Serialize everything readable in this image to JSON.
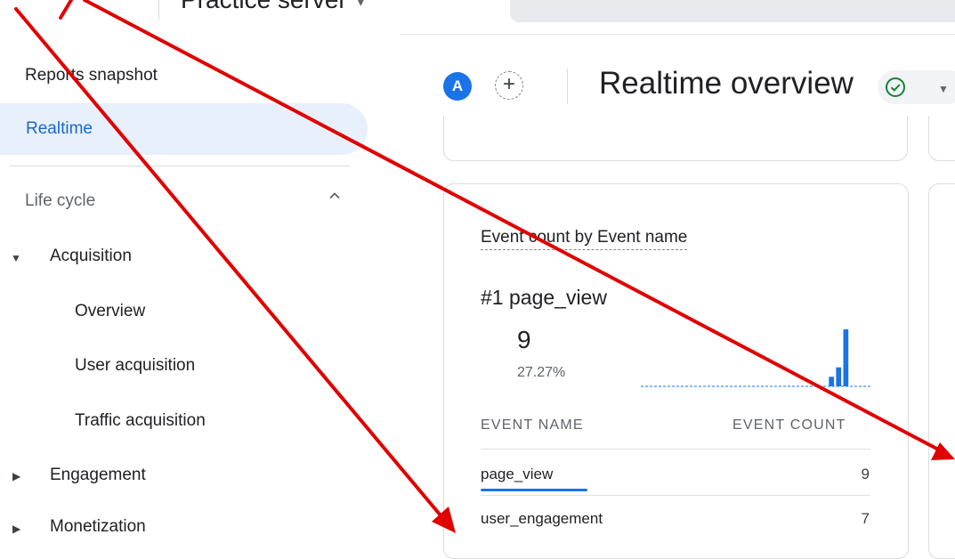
{
  "topbar": {
    "property_name": "Practice server",
    "property_caret": "▾"
  },
  "sidebar": {
    "items": [
      {
        "label": "Reports snapshot"
      },
      {
        "label": "Realtime",
        "active": true
      }
    ],
    "section": {
      "label": "Life cycle"
    },
    "groups": [
      {
        "label": "Acquisition",
        "expanded": true,
        "children": [
          "Overview",
          "User acquisition",
          "Traffic acquisition"
        ]
      },
      {
        "label": "Engagement",
        "expanded": false
      },
      {
        "label": "Monetization",
        "expanded": false
      }
    ]
  },
  "header": {
    "avatar_letter": "A",
    "add_label": "+",
    "title": "Realtime overview"
  },
  "card": {
    "title": "Event count by Event name",
    "rank": "#1",
    "top_event": "page_view",
    "top_value": "9",
    "top_percent": "27.27%",
    "sparkline": [
      0,
      0,
      0,
      0,
      0,
      0,
      0,
      0,
      0,
      0,
      0,
      0,
      0,
      0,
      0,
      0,
      0,
      0,
      0,
      0,
      0,
      0,
      0,
      0,
      0,
      0,
      1,
      2,
      6,
      0,
      0,
      0
    ],
    "columns": [
      "EVENT NAME",
      "EVENT COUNT"
    ],
    "rows": [
      {
        "name": "page_view",
        "count": "9"
      },
      {
        "name": "user_engagement",
        "count": "7"
      }
    ]
  },
  "colors": {
    "accent": "#1a73e8",
    "active_nav_bg": "#e8f0fe",
    "active_nav_text": "#1967d2",
    "success": "#188038",
    "annotation_arrow": "#e00000"
  }
}
